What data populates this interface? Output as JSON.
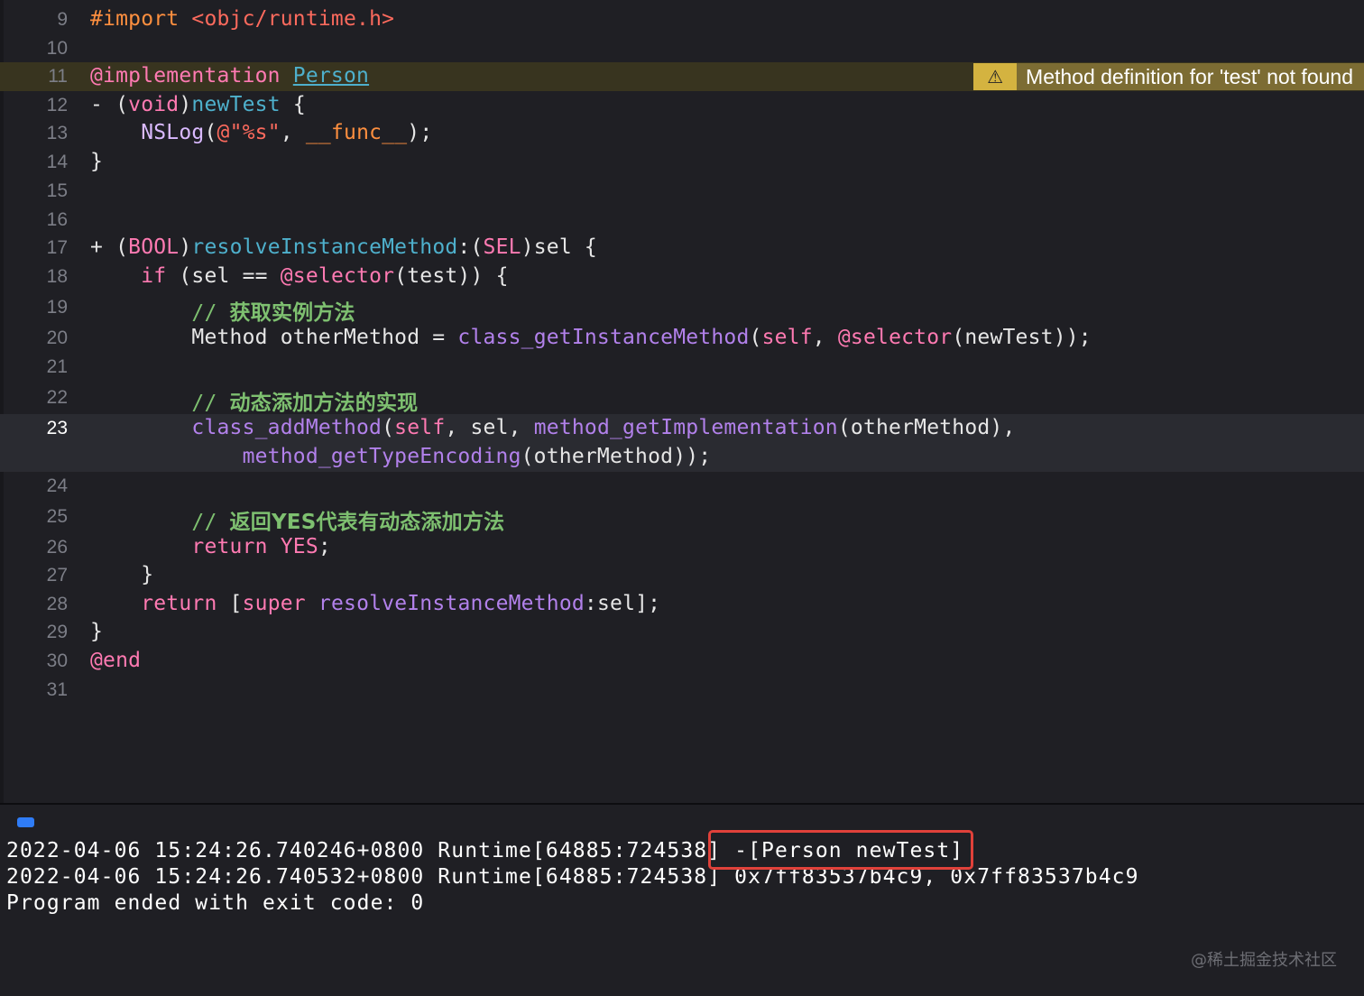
{
  "editor": {
    "lines": [
      {
        "n": "9"
      },
      {
        "n": "10"
      },
      {
        "n": "11"
      },
      {
        "n": "12"
      },
      {
        "n": "13"
      },
      {
        "n": "14"
      },
      {
        "n": "15"
      },
      {
        "n": "16"
      },
      {
        "n": "17"
      },
      {
        "n": "18"
      },
      {
        "n": "19"
      },
      {
        "n": "20"
      },
      {
        "n": "21"
      },
      {
        "n": "22"
      },
      {
        "n": "23"
      },
      {
        "n": "24"
      },
      {
        "n": "25"
      },
      {
        "n": "26"
      },
      {
        "n": "27"
      },
      {
        "n": "28"
      },
      {
        "n": "29"
      },
      {
        "n": "30"
      },
      {
        "n": "31"
      }
    ],
    "tokens": {
      "l9_import": "#import",
      "l9_header": "<objc/runtime.h>",
      "l11_impl": "@implementation",
      "l11_class": "Person",
      "l12_a": "- (",
      "l12_void": "void",
      "l12_b": ")",
      "l12_name": "newTest",
      "l12_c": " {",
      "l13_nslog": "NSLog",
      "l13_a": "(",
      "l13_str": "@\"%s\"",
      "l13_b": ", ",
      "l13_func": "__func__",
      "l13_c": ");",
      "l14": "}",
      "l17_a": "+ (",
      "l17_bool": "BOOL",
      "l17_b": ")",
      "l17_name": "resolveInstanceMethod",
      "l17_c": ":(",
      "l17_sel": "SEL",
      "l17_d": ")sel {",
      "l18_if": "if",
      "l18_a": " (sel == ",
      "l18_selector": "@selector",
      "l18_b": "(test)) {",
      "l19_slashes": "// ",
      "l19_text": "获取实例方法",
      "l20_method": "Method",
      "l20_a": " otherMethod = ",
      "l20_call": "class_getInstanceMethod",
      "l20_b": "(",
      "l20_self": "self",
      "l20_c": ", ",
      "l20_selector": "@selector",
      "l20_d": "(newTest));",
      "l22_slashes": "// ",
      "l22_text": "动态添加方法的实现",
      "l23_call": "class_addMethod",
      "l23_a": "(",
      "l23_self": "self",
      "l23_b": ", sel, ",
      "l23_call2": "method_getImplementation",
      "l23_c": "(otherMethod),",
      "l23w_call": "method_getTypeEncoding",
      "l23w_a": "(otherMethod));",
      "l25_slashes": "// ",
      "l25_text": "返回YES代表有动态添加方法",
      "l26_return": "return",
      "l26_yes": "YES",
      "l26_a": ";",
      "l27": "}",
      "l28_return": "return",
      "l28_a": " [",
      "l28_super": "super",
      "l28_call": "resolveInstanceMethod",
      "l28_b": ":sel];",
      "l29": "}",
      "l30_end": "@end"
    },
    "warning": {
      "icon": "warning-triangle-icon",
      "symbol": "⚠",
      "message": "Method definition for 'test' not found"
    }
  },
  "console": {
    "lines": [
      "2022-04-06 15:24:26.740246+0800 Runtime[64885:724538] -[Person newTest]",
      "2022-04-06 15:24:26.740532+0800 Runtime[64885:724538] 0x7ff83537b4c9, 0x7ff83537b4c9",
      "Program ended with exit code: 0"
    ]
  },
  "watermark": "@稀土掘金技术社区",
  "colors": {
    "background": "#1f1f24",
    "keyword": "#ff7ab2",
    "preprocessor": "#fd8f3f",
    "comment": "#7ec070",
    "call": "#b281eb",
    "declaration": "#4eb0cc",
    "warning": "#d4b340",
    "highlight_box": "#e0413a",
    "console_toggle": "#2f7cf6"
  }
}
